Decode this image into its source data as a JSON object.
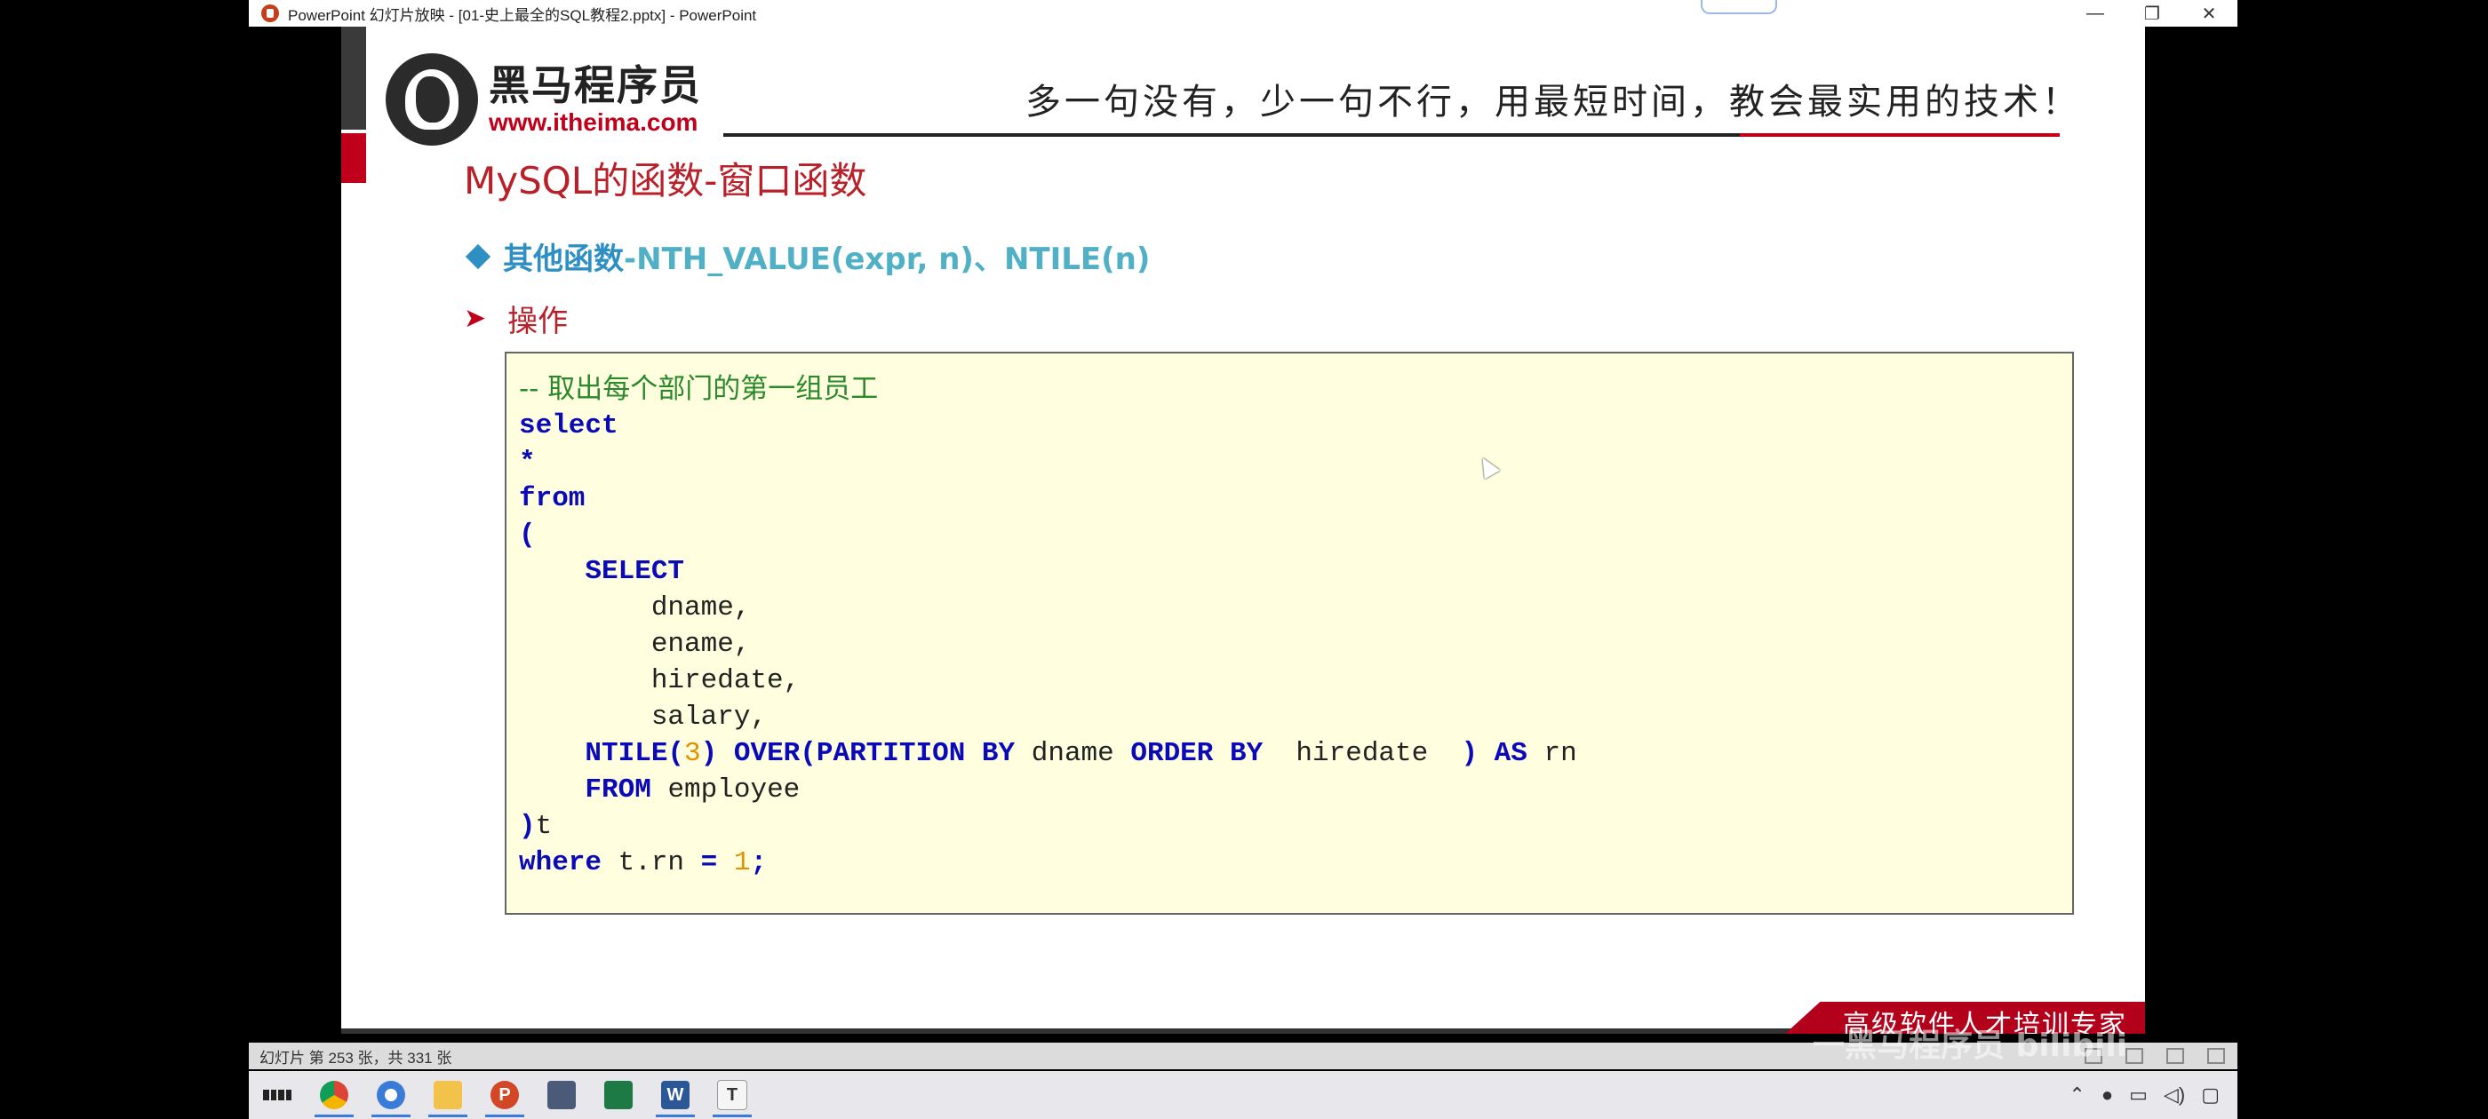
{
  "window": {
    "title": "PowerPoint 幻灯片放映 - [01-史上最全的SQL教程2.pptx] - PowerPoint",
    "controls": {
      "minimize": "—",
      "restore": "❐",
      "close": "✕"
    }
  },
  "slide": {
    "logo_cn": "黑马程序员",
    "logo_url": "www.itheima.com",
    "slogan": "多一句没有，少一句不行，用最短时间，教会最实用的技术！",
    "title": "MySQL的函数-窗口函数",
    "subtitle_cn": "其他函数",
    "subtitle_en": "-NTH_VALUE(expr, n)、NTILE(n)",
    "op_label": "操作",
    "code": {
      "comment": "-- 取出每个部门的第一组员工",
      "lines": [
        "select",
        "*",
        "from",
        "(",
        "SELECT",
        "dname,",
        "ename,",
        "hiredate,",
        "salary,",
        "NTILE(",
        "3",
        ") OVER(PARTITION BY",
        "dname",
        "ORDER BY",
        "hiredate",
        ") AS",
        "rn",
        "FROM",
        "employee",
        ")",
        "t",
        "where",
        "t.rn",
        "=",
        "1",
        ";"
      ]
    },
    "footer_badge": "高级软件人才培训专家"
  },
  "statusbar": {
    "slide_count": "幻灯片 第 253 张，共 331 张"
  },
  "taskbar": {
    "items": [
      {
        "icon": "windows-start-icon"
      },
      {
        "icon": "chrome-icon"
      },
      {
        "icon": "browser-icon"
      },
      {
        "icon": "folder-icon"
      },
      {
        "icon": "powerpoint-icon",
        "label": "P"
      },
      {
        "icon": "calculator-icon"
      },
      {
        "icon": "excel-icon"
      },
      {
        "icon": "word-icon",
        "label": "W"
      },
      {
        "icon": "typora-icon",
        "label": "T"
      }
    ]
  },
  "watermark": "一黑马程序员 bilibili"
}
